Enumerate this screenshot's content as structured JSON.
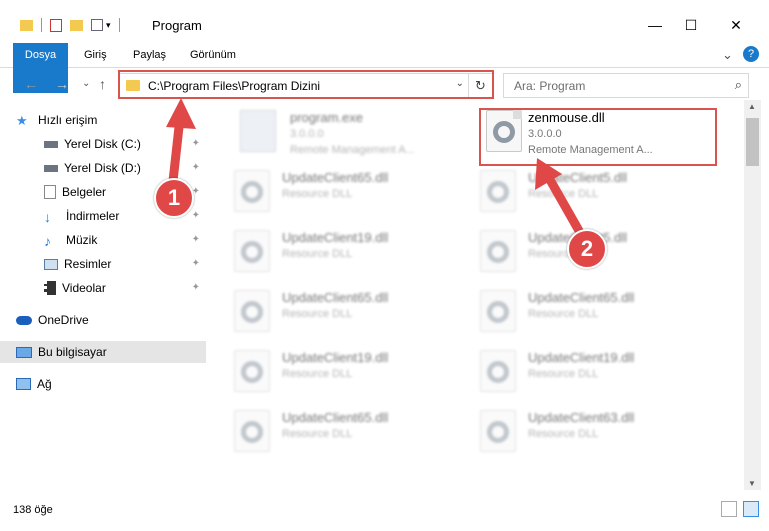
{
  "window": {
    "title": "Program",
    "minimize": "—",
    "maximize": "☐",
    "close": "✕"
  },
  "ribbon": {
    "tabs": [
      "Dosya",
      "Giriş",
      "Paylaş",
      "Görünüm"
    ],
    "expand": "⌄",
    "help": "?"
  },
  "nav": {
    "back": "←",
    "forward": "→",
    "recent": "⌄",
    "up": "↑",
    "address": "C:\\Program Files\\Program Dizini",
    "address_dropdown": "⌄",
    "refresh": "↻",
    "search_placeholder": "Ara: Program",
    "search_icon": "⌕"
  },
  "sidebar": {
    "items": [
      {
        "label": "Hızlı erişim",
        "icon": "star-icon",
        "pinned": false
      },
      {
        "label": "Yerel Disk (C:)",
        "icon": "drive-icon",
        "pinned": true
      },
      {
        "label": "Yerel Disk (D:)",
        "icon": "drive-icon",
        "pinned": true
      },
      {
        "label": "Belgeler",
        "icon": "documents-icon",
        "pinned": true
      },
      {
        "label": "İndirmeler",
        "icon": "download-icon",
        "pinned": true
      },
      {
        "label": "Müzik",
        "icon": "music-icon",
        "pinned": true
      },
      {
        "label": "Resimler",
        "icon": "pictures-icon",
        "pinned": true
      },
      {
        "label": "Videolar",
        "icon": "videos-icon",
        "pinned": true
      },
      {
        "label": "OneDrive",
        "icon": "cloud-icon",
        "pinned": false
      },
      {
        "label": "Bu bilgisayar",
        "icon": "computer-icon",
        "pinned": false
      },
      {
        "label": "Ağ",
        "icon": "network-icon",
        "pinned": false
      }
    ],
    "pin_glyph": "📌"
  },
  "files": {
    "program": {
      "name": "program.exe",
      "version": "3.0.0.0",
      "desc": "Remote Management A..."
    },
    "zenmouse": {
      "name": "zenmouse.dll",
      "version": "3.0.0.0",
      "desc": "Remote Management A..."
    },
    "left_column": [
      {
        "name": "UpdateClient65.dll",
        "desc": "Resource DLL"
      },
      {
        "name": "UpdateClient19.dll",
        "desc": "Resource DLL"
      },
      {
        "name": "UpdateClient65.dll",
        "desc": "Resource DLL"
      },
      {
        "name": "UpdateClient19.dll",
        "desc": "Resource DLL"
      },
      {
        "name": "UpdateClient65.dll",
        "desc": "Resource DLL"
      }
    ],
    "right_column": [
      {
        "name": "UpdateClient5.dll",
        "desc": "Resource DLL"
      },
      {
        "name": "UpdateClient5.dll",
        "desc": "Resource DLL"
      },
      {
        "name": "UpdateClient65.dll",
        "desc": "Resource DLL"
      },
      {
        "name": "UpdateClient19.dll",
        "desc": "Resource DLL"
      },
      {
        "name": "UpdateClient63.dll",
        "desc": "Resource DLL"
      }
    ]
  },
  "status": {
    "count": "138 öğe"
  },
  "callouts": {
    "one": "1",
    "two": "2"
  },
  "colors": {
    "accent": "#1979ca",
    "highlight": "#d9534f",
    "callout": "#e04848"
  }
}
